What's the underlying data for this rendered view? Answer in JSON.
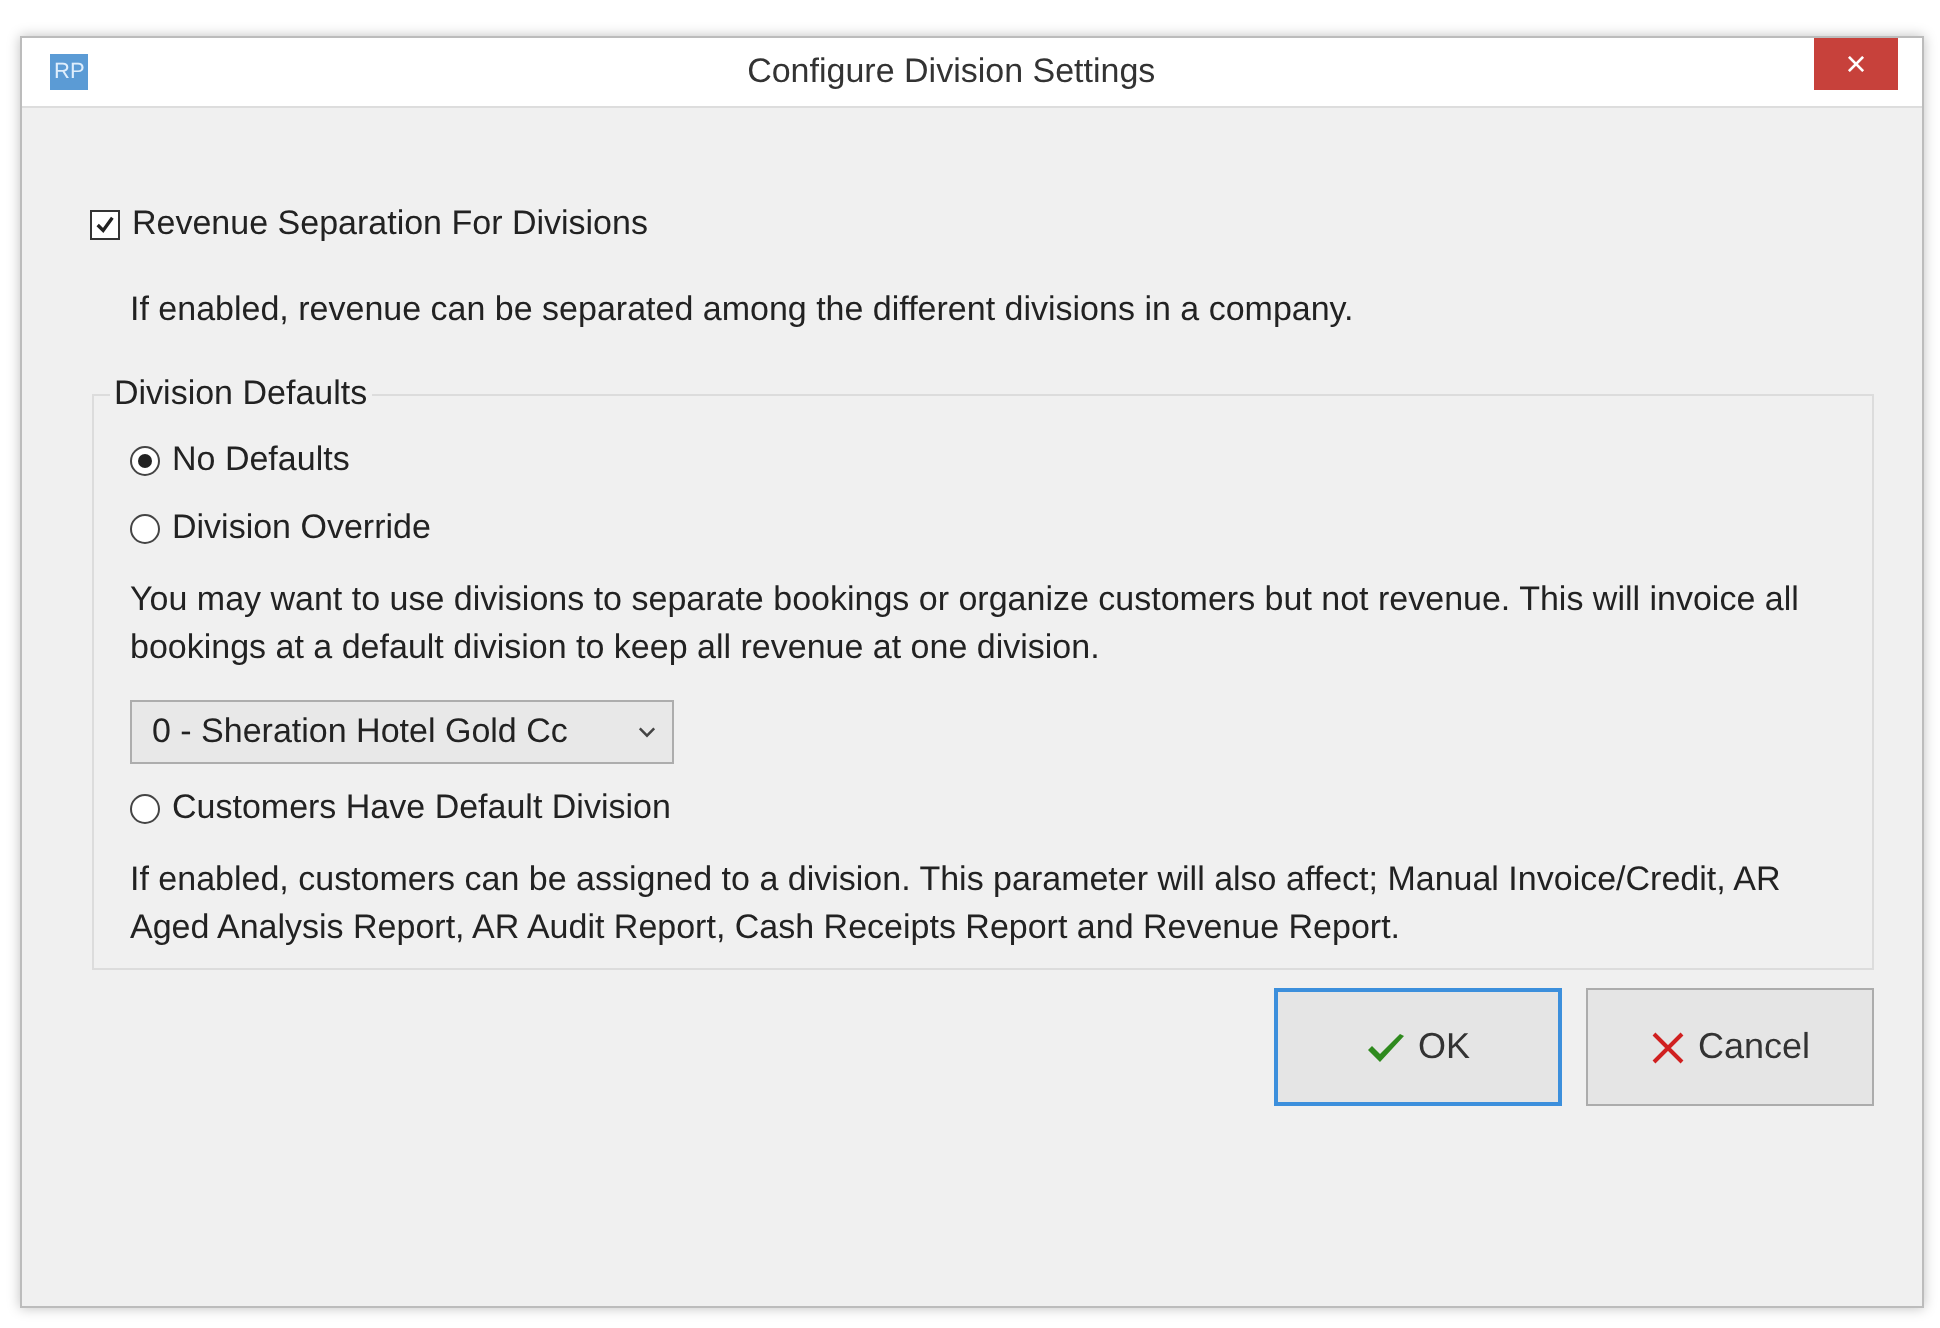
{
  "window": {
    "app_icon": "RP",
    "title": "Configure Division Settings",
    "close": "×"
  },
  "revenue_separation": {
    "label": "Revenue Separation For Divisions",
    "checked": true,
    "description": "If enabled, revenue can be separated among the different divisions in a company."
  },
  "division_defaults": {
    "title": "Division Defaults",
    "options": [
      {
        "label": "No Defaults",
        "selected": true
      },
      {
        "label": "Division Override",
        "selected": false,
        "description": "You may want to use divisions to separate bookings or organize customers but not revenue. This will invoice all bookings at a default division to keep all revenue at one division.",
        "dropdown": {
          "value": "0 - Sheration Hotel Gold Cc"
        }
      },
      {
        "label": "Customers Have Default Division",
        "selected": false,
        "description": "If enabled, customers can be assigned to a division. This parameter will also affect; Manual Invoice/Credit, AR Aged Analysis Report, AR Audit Report, Cash Receipts Report and Revenue Report."
      }
    ]
  },
  "buttons": [
    {
      "kind": "ok",
      "label": "OK",
      "focused": true
    },
    {
      "kind": "cancel",
      "label": "Cancel",
      "focused": false
    }
  ]
}
